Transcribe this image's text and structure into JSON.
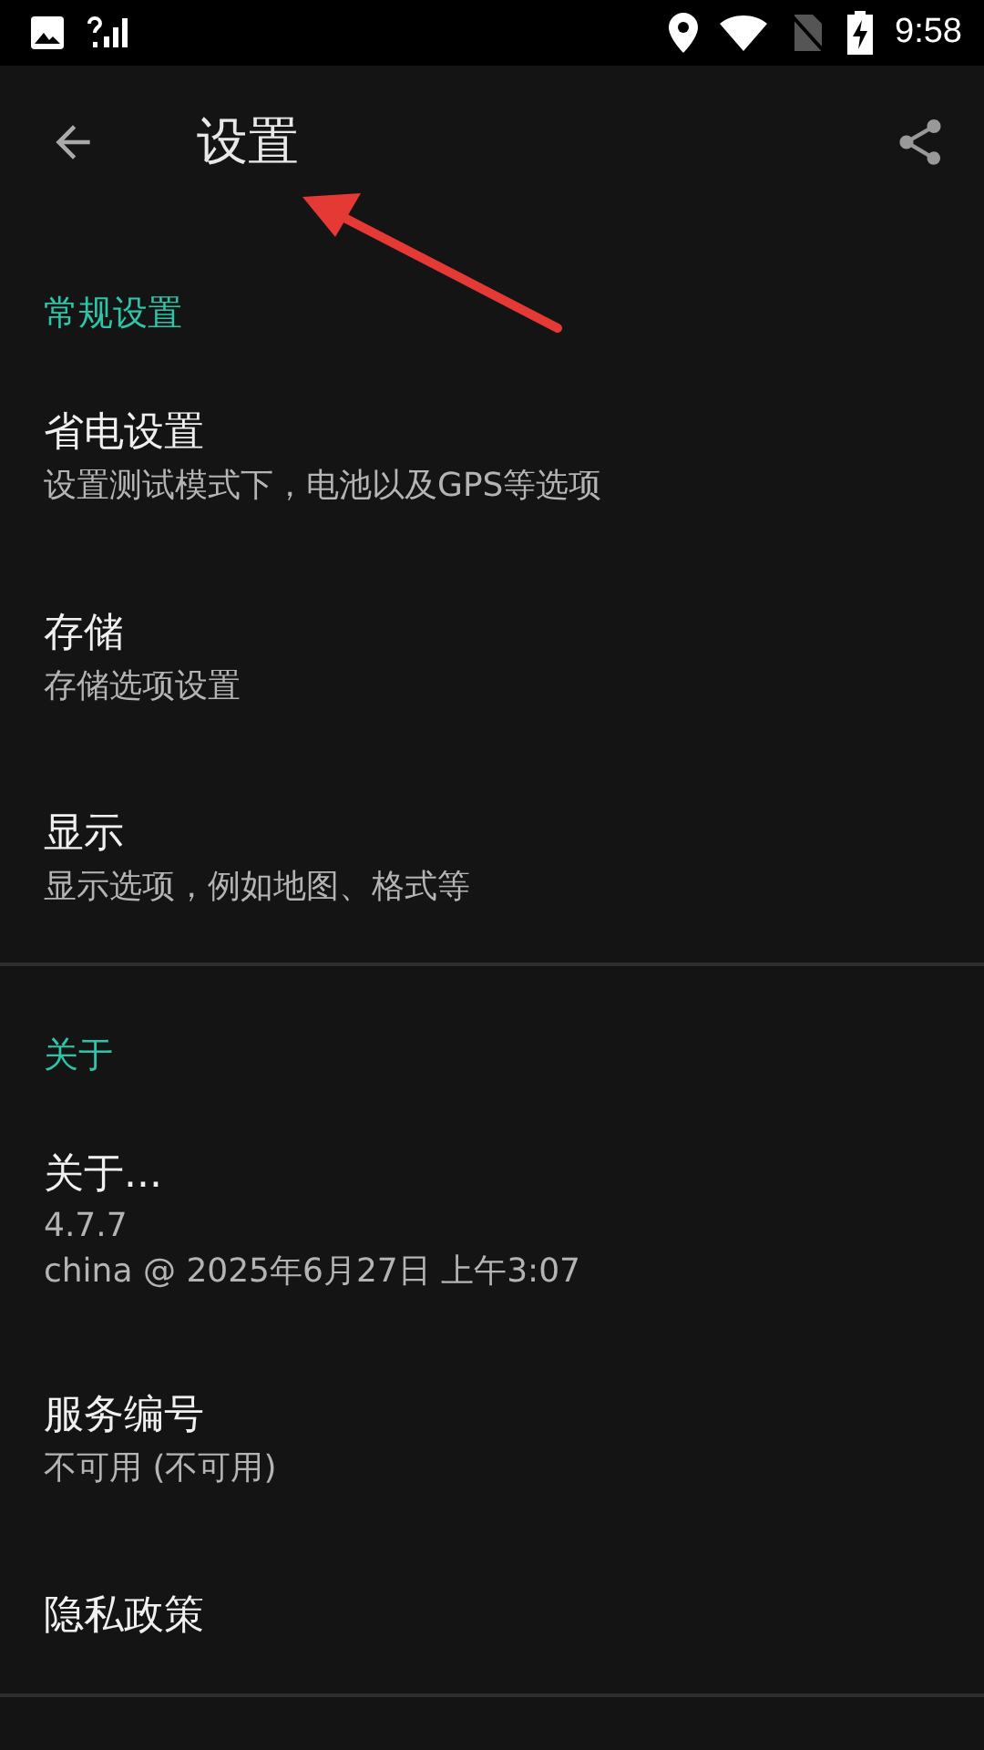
{
  "status_bar": {
    "time": "9:58"
  },
  "app_bar": {
    "title": "设置"
  },
  "sections": [
    {
      "header": "常规设置",
      "items": [
        {
          "title": "省电设置",
          "summary": [
            "设置测试模式下，电池以及GPS等选项"
          ]
        },
        {
          "title": "存储",
          "summary": [
            "存储选项设置"
          ]
        },
        {
          "title": "显示",
          "summary": [
            "显示选项，例如地图、格式等"
          ]
        }
      ]
    },
    {
      "header": "关于",
      "items": [
        {
          "title": "关于...",
          "summary": [
            "4.7.7",
            "china @ 2025年6月27日 上午3:07"
          ]
        },
        {
          "title": "服务编号",
          "summary": [
            "不可用 (不可用)"
          ]
        },
        {
          "title": "隐私政策"
        }
      ]
    }
  ]
}
